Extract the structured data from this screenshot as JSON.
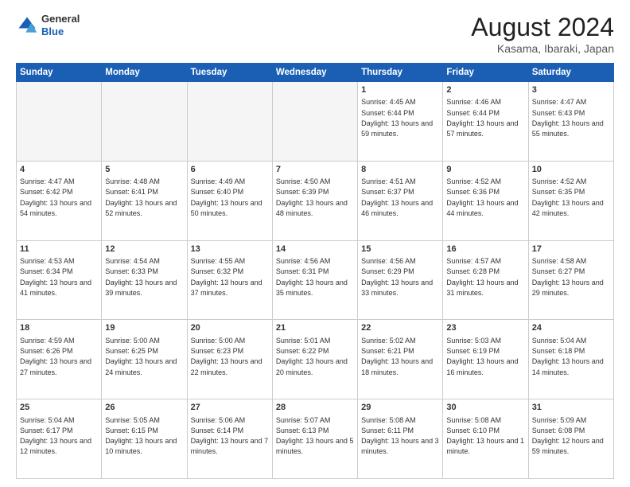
{
  "header": {
    "logo": {
      "line1": "General",
      "line2": "Blue"
    },
    "title": "August 2024",
    "location": "Kasama, Ibaraki, Japan"
  },
  "weekdays": [
    "Sunday",
    "Monday",
    "Tuesday",
    "Wednesday",
    "Thursday",
    "Friday",
    "Saturday"
  ],
  "weeks": [
    [
      {
        "day": "",
        "empty": true
      },
      {
        "day": "",
        "empty": true
      },
      {
        "day": "",
        "empty": true
      },
      {
        "day": "",
        "empty": true
      },
      {
        "day": "1",
        "sunrise": "4:45 AM",
        "sunset": "6:44 PM",
        "daylight": "13 hours and 59 minutes."
      },
      {
        "day": "2",
        "sunrise": "4:46 AM",
        "sunset": "6:44 PM",
        "daylight": "13 hours and 57 minutes."
      },
      {
        "day": "3",
        "sunrise": "4:47 AM",
        "sunset": "6:43 PM",
        "daylight": "13 hours and 55 minutes."
      }
    ],
    [
      {
        "day": "4",
        "sunrise": "4:47 AM",
        "sunset": "6:42 PM",
        "daylight": "13 hours and 54 minutes."
      },
      {
        "day": "5",
        "sunrise": "4:48 AM",
        "sunset": "6:41 PM",
        "daylight": "13 hours and 52 minutes."
      },
      {
        "day": "6",
        "sunrise": "4:49 AM",
        "sunset": "6:40 PM",
        "daylight": "13 hours and 50 minutes."
      },
      {
        "day": "7",
        "sunrise": "4:50 AM",
        "sunset": "6:39 PM",
        "daylight": "13 hours and 48 minutes."
      },
      {
        "day": "8",
        "sunrise": "4:51 AM",
        "sunset": "6:37 PM",
        "daylight": "13 hours and 46 minutes."
      },
      {
        "day": "9",
        "sunrise": "4:52 AM",
        "sunset": "6:36 PM",
        "daylight": "13 hours and 44 minutes."
      },
      {
        "day": "10",
        "sunrise": "4:52 AM",
        "sunset": "6:35 PM",
        "daylight": "13 hours and 42 minutes."
      }
    ],
    [
      {
        "day": "11",
        "sunrise": "4:53 AM",
        "sunset": "6:34 PM",
        "daylight": "13 hours and 41 minutes."
      },
      {
        "day": "12",
        "sunrise": "4:54 AM",
        "sunset": "6:33 PM",
        "daylight": "13 hours and 39 minutes."
      },
      {
        "day": "13",
        "sunrise": "4:55 AM",
        "sunset": "6:32 PM",
        "daylight": "13 hours and 37 minutes."
      },
      {
        "day": "14",
        "sunrise": "4:56 AM",
        "sunset": "6:31 PM",
        "daylight": "13 hours and 35 minutes."
      },
      {
        "day": "15",
        "sunrise": "4:56 AM",
        "sunset": "6:29 PM",
        "daylight": "13 hours and 33 minutes."
      },
      {
        "day": "16",
        "sunrise": "4:57 AM",
        "sunset": "6:28 PM",
        "daylight": "13 hours and 31 minutes."
      },
      {
        "day": "17",
        "sunrise": "4:58 AM",
        "sunset": "6:27 PM",
        "daylight": "13 hours and 29 minutes."
      }
    ],
    [
      {
        "day": "18",
        "sunrise": "4:59 AM",
        "sunset": "6:26 PM",
        "daylight": "13 hours and 27 minutes."
      },
      {
        "day": "19",
        "sunrise": "5:00 AM",
        "sunset": "6:25 PM",
        "daylight": "13 hours and 24 minutes."
      },
      {
        "day": "20",
        "sunrise": "5:00 AM",
        "sunset": "6:23 PM",
        "daylight": "13 hours and 22 minutes."
      },
      {
        "day": "21",
        "sunrise": "5:01 AM",
        "sunset": "6:22 PM",
        "daylight": "13 hours and 20 minutes."
      },
      {
        "day": "22",
        "sunrise": "5:02 AM",
        "sunset": "6:21 PM",
        "daylight": "13 hours and 18 minutes."
      },
      {
        "day": "23",
        "sunrise": "5:03 AM",
        "sunset": "6:19 PM",
        "daylight": "13 hours and 16 minutes."
      },
      {
        "day": "24",
        "sunrise": "5:04 AM",
        "sunset": "6:18 PM",
        "daylight": "13 hours and 14 minutes."
      }
    ],
    [
      {
        "day": "25",
        "sunrise": "5:04 AM",
        "sunset": "6:17 PM",
        "daylight": "13 hours and 12 minutes."
      },
      {
        "day": "26",
        "sunrise": "5:05 AM",
        "sunset": "6:15 PM",
        "daylight": "13 hours and 10 minutes."
      },
      {
        "day": "27",
        "sunrise": "5:06 AM",
        "sunset": "6:14 PM",
        "daylight": "13 hours and 7 minutes."
      },
      {
        "day": "28",
        "sunrise": "5:07 AM",
        "sunset": "6:13 PM",
        "daylight": "13 hours and 5 minutes."
      },
      {
        "day": "29",
        "sunrise": "5:08 AM",
        "sunset": "6:11 PM",
        "daylight": "13 hours and 3 minutes."
      },
      {
        "day": "30",
        "sunrise": "5:08 AM",
        "sunset": "6:10 PM",
        "daylight": "13 hours and 1 minute."
      },
      {
        "day": "31",
        "sunrise": "5:09 AM",
        "sunset": "6:08 PM",
        "daylight": "12 hours and 59 minutes."
      }
    ]
  ]
}
